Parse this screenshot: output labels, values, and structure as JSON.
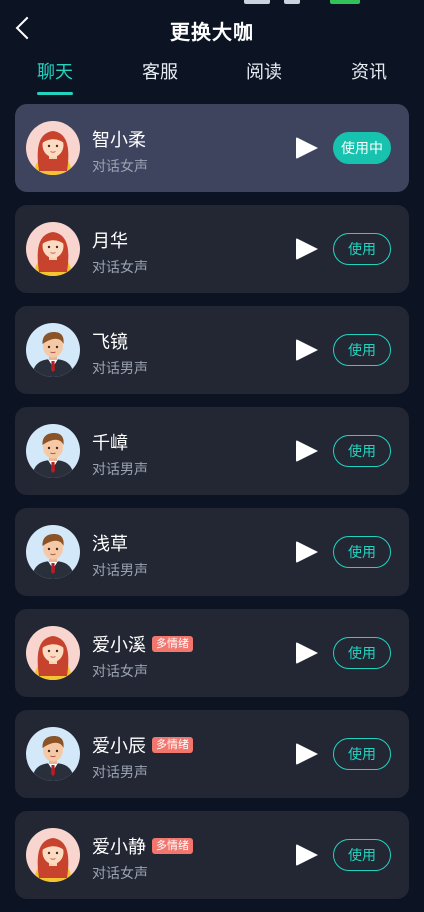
{
  "header": {
    "title": "更换大咖"
  },
  "tabs": [
    {
      "label": "聊天",
      "active": true
    },
    {
      "label": "客服",
      "active": false
    },
    {
      "label": "阅读",
      "active": false
    },
    {
      "label": "资讯",
      "active": false
    }
  ],
  "colors": {
    "accent": "#22d3c0",
    "background": "#0c1424",
    "card": "#232733",
    "card_selected": "#3e445e",
    "badge": "#f0766e"
  },
  "icons": {
    "back": "chevron-left-icon",
    "play": "play-icon"
  },
  "voices": [
    {
      "name": "智小柔",
      "desc": "对话女声",
      "gender": "female",
      "badge": "",
      "button": "使用中",
      "selected": true
    },
    {
      "name": "月华",
      "desc": "对话女声",
      "gender": "female",
      "badge": "",
      "button": "使用",
      "selected": false
    },
    {
      "name": "飞镜",
      "desc": "对话男声",
      "gender": "male",
      "badge": "",
      "button": "使用",
      "selected": false
    },
    {
      "name": "千嶂",
      "desc": "对话男声",
      "gender": "male",
      "badge": "",
      "button": "使用",
      "selected": false
    },
    {
      "name": "浅草",
      "desc": "对话男声",
      "gender": "male",
      "badge": "",
      "button": "使用",
      "selected": false
    },
    {
      "name": "爱小溪",
      "desc": "对话女声",
      "gender": "female",
      "badge": "多情绪",
      "button": "使用",
      "selected": false
    },
    {
      "name": "爱小辰",
      "desc": "对话男声",
      "gender": "male",
      "badge": "多情绪",
      "button": "使用",
      "selected": false
    },
    {
      "name": "爱小静",
      "desc": "对话女声",
      "gender": "female",
      "badge": "多情绪",
      "button": "使用",
      "selected": false
    }
  ]
}
